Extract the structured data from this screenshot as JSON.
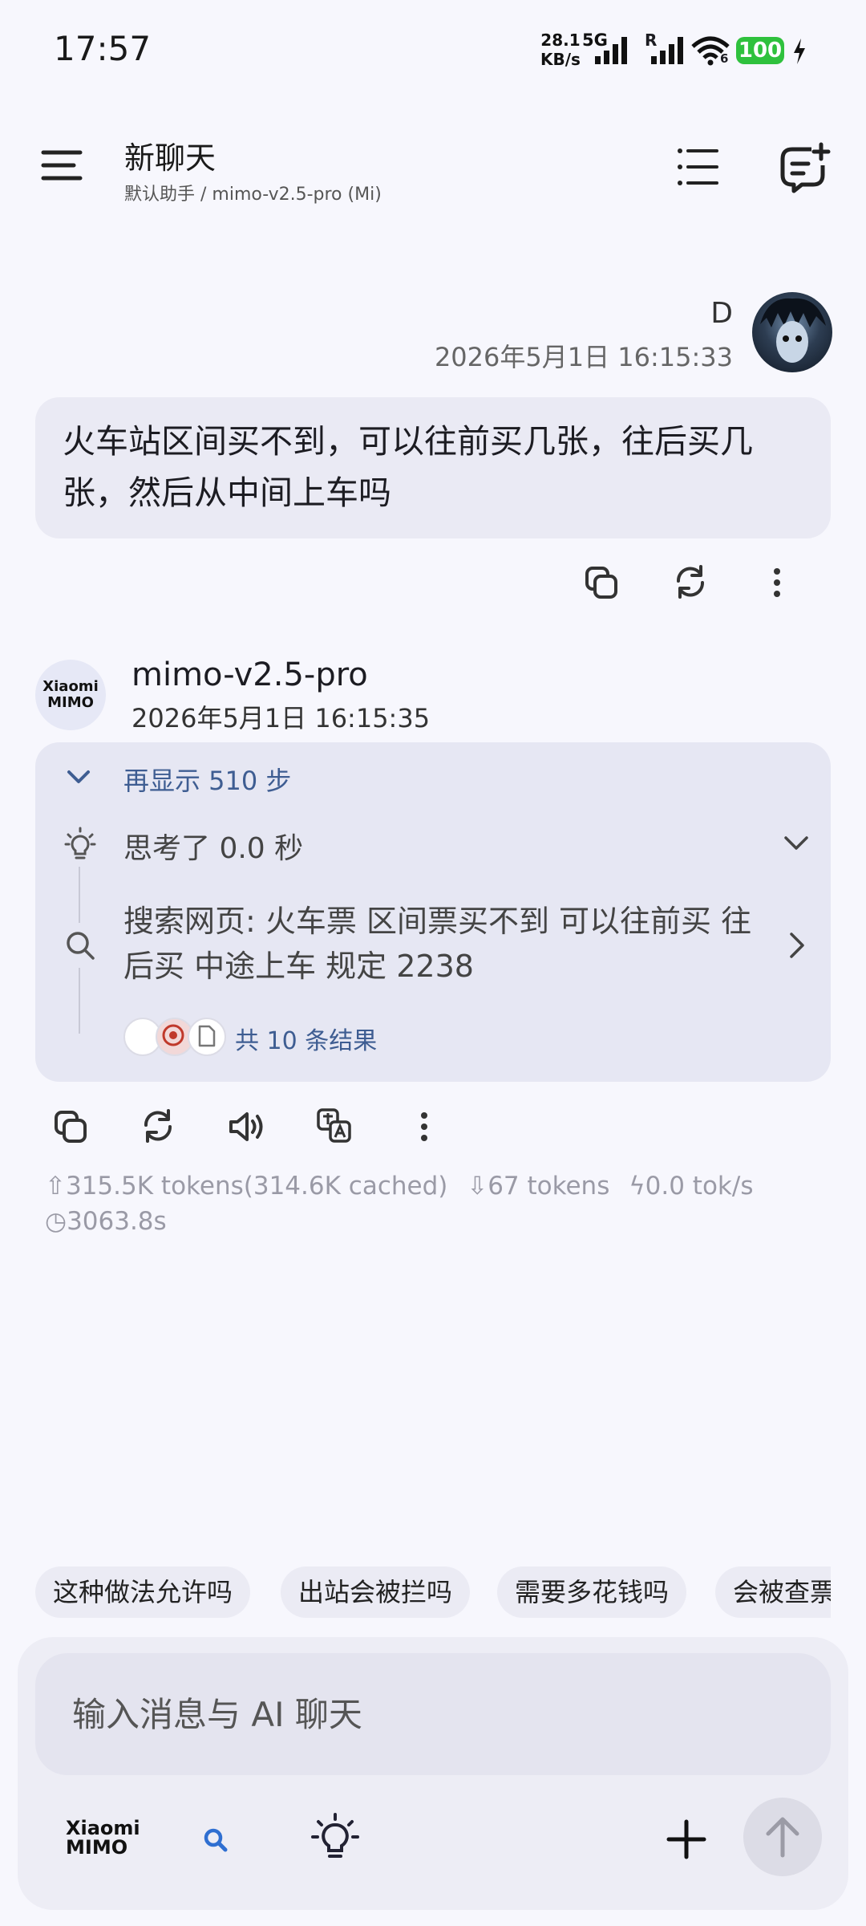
{
  "status_bar": {
    "time": "17:57",
    "net_speed_value": "28.1",
    "net_speed_unit": "KB/s",
    "network": "5G",
    "roaming": "R",
    "wifi_band": "6",
    "battery": "100"
  },
  "header": {
    "title": "新聊天",
    "subtitle": "默认助手 / mimo-v2.5-pro (Mi)"
  },
  "user_message": {
    "name": "D",
    "timestamp": "2026年5月1日 16:15:33",
    "text": "火车站区间买不到，可以往前买几张，往后买几张，然后从中间上车吗"
  },
  "assistant": {
    "logo_line1": "Xiaomi",
    "logo_line2": "MIMO",
    "model": "mimo-v2.5-pro",
    "timestamp": "2026年5月1日 16:15:35",
    "steps_label": "再显示 510 步",
    "thinking_label": "思考了 0.0 秒",
    "search_label": "搜索网页: 火车票 区间票买不到 可以往前买 往后买 中途上车 规定 2238",
    "results_label": "共 10 条结果",
    "stats": {
      "input_tokens": "315.5K tokens(314.6K cached)",
      "output_tokens": "67 tokens",
      "speed": "0.0 tok/s",
      "duration": "3063.8s"
    }
  },
  "suggestions": [
    "这种做法允许吗",
    "出站会被拦吗",
    "需要多花钱吗",
    "会被查票吗"
  ],
  "composer": {
    "placeholder": "输入消息与 AI 聊天",
    "logo_line1": "Xiaomi",
    "logo_line2": "MIMO"
  },
  "colors": {
    "accent": "#3e5d92",
    "search_icon": "#2f6fd1",
    "battery": "#2fc13d",
    "background": "#f7f7fd"
  }
}
